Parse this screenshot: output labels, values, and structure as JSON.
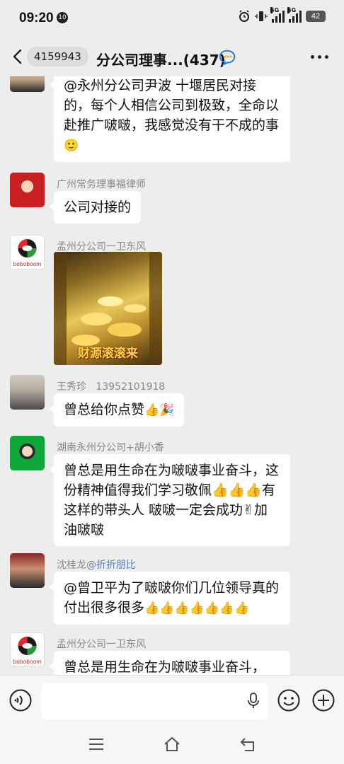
{
  "status": {
    "time": "09:20",
    "notif_count": "10",
    "net1": "5G",
    "net2": "5G",
    "battery": "42"
  },
  "nav": {
    "badge": "4159943",
    "title": "分公司理事...(437)"
  },
  "messages": [
    {
      "sender": "",
      "text": "@永州分公司尹波  十堰居民对接的，每个人相信公司到极致，全命以赴推广啵啵，我感觉没有干不成的事",
      "emoji": "🙂"
    },
    {
      "sender": "广州常务理事福律师",
      "text": "公司对接的"
    },
    {
      "sender": "孟州分公司一卫东风",
      "image_caption": "财源滚滚来",
      "avatar_text": "boboboom"
    },
    {
      "sender": "王秀珍",
      "sender_extra": "13952101918",
      "text": "曾总给你点赞",
      "emoji": "👍🎉"
    },
    {
      "sender": "湖南永州分公司+胡小香",
      "text": "曾总是用生命在为啵啵事业奋斗，这份精神值得我们学习敬佩👍👍👍有这样的带头人 啵啵一定会成功✌加油啵啵"
    },
    {
      "sender": "沈桂龙",
      "sender_mention": "@折折朋比",
      "text": "@曾卫平为了啵啵你们几位领导真的付出很多很多",
      "emoji": "👍👍👍👍👍👍👍"
    },
    {
      "sender": "孟州分公司一卫东风",
      "text": "曾总是用生命在为啵啵事业奋斗，",
      "avatar_text": "boboboom"
    }
  ]
}
